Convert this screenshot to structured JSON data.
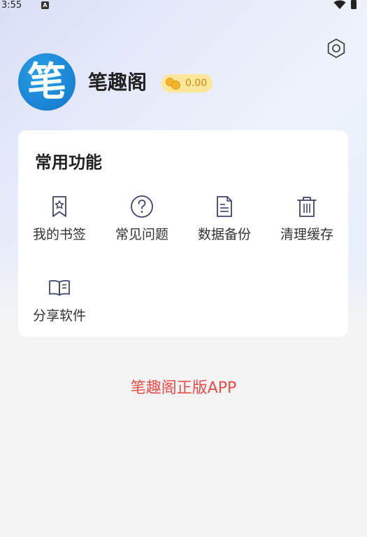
{
  "status_bar": {
    "time": "3:55",
    "notification_icon_text": "A"
  },
  "profile": {
    "avatar_char": "笔",
    "username": "笔趣阁",
    "coins": "0.00"
  },
  "functions_card": {
    "title": "常用功能",
    "items": [
      {
        "label": "我的书签",
        "icon": "bookmark-star-icon"
      },
      {
        "label": "常见问题",
        "icon": "question-circle-icon"
      },
      {
        "label": "数据备份",
        "icon": "document-icon"
      },
      {
        "label": "清理缓存",
        "icon": "trash-icon"
      },
      {
        "label": "分享软件",
        "icon": "open-book-icon"
      }
    ]
  },
  "footer": {
    "text": "笔趣阁正版APP"
  },
  "colors": {
    "accent_red": "#ec4b47",
    "avatar_blue": "#1b86d6",
    "coin_badge": "#fbe69a",
    "icon_stroke": "#3d4468"
  }
}
